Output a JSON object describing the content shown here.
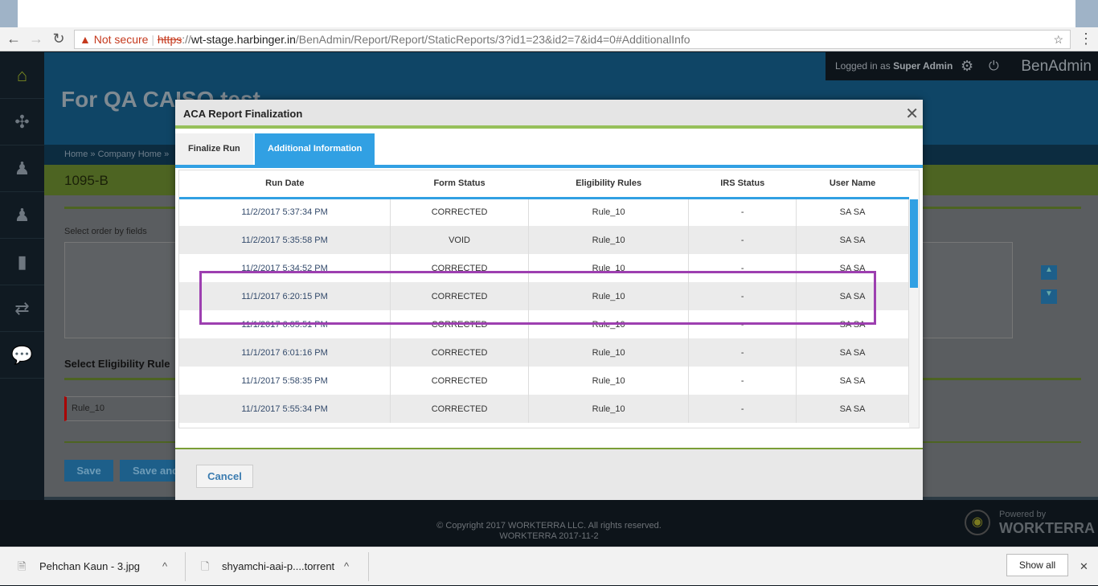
{
  "browser": {
    "security": "Not secure",
    "url_scheme": "https",
    "url_host": "wt-stage.harbinger.in",
    "url_path": "/BenAdmin/Report/Report/StaticReports/3?id1=23&id2=7&id4=0#AdditionalInfo"
  },
  "app": {
    "title": "For QA CAISO test",
    "logged_in_prefix": "Logged in as",
    "user": "Super Admin",
    "brand": "BenAdmin",
    "breadcrumb": "Home » Company Home »",
    "section": "1095-B",
    "order_label": "Select order by fields",
    "elig_label": "Select Eligibility Rule",
    "elig_value": "Rule_10",
    "save": "Save",
    "save_and": "Save and"
  },
  "modal": {
    "title": "ACA Report Finalization",
    "close": "✕",
    "tabs": [
      {
        "label": "Finalize Run",
        "active": false
      },
      {
        "label": "Additional Information",
        "active": true
      }
    ],
    "columns": [
      "Run Date",
      "Form Status",
      "Eligibility Rules",
      "IRS Status",
      "User Name"
    ],
    "rows": [
      [
        "11/2/2017 5:37:34 PM",
        "CORRECTED",
        "Rule_10",
        "-",
        "SA SA"
      ],
      [
        "11/2/2017 5:35:58 PM",
        "VOID",
        "Rule_10",
        "-",
        "SA SA"
      ],
      [
        "11/2/2017 5:34:52 PM",
        "CORRECTED",
        "Rule_10",
        "-",
        "SA SA"
      ],
      [
        "11/1/2017 6:20:15 PM",
        "CORRECTED",
        "Rule_10",
        "-",
        "SA SA"
      ],
      [
        "11/1/2017 6:05:51 PM",
        "CORRECTED",
        "Rule_10",
        "-",
        "SA SA"
      ],
      [
        "11/1/2017 6:01:16 PM",
        "CORRECTED",
        "Rule_10",
        "-",
        "SA SA"
      ],
      [
        "11/1/2017 5:58:35 PM",
        "CORRECTED",
        "Rule_10",
        "-",
        "SA SA"
      ],
      [
        "11/1/2017 5:55:34 PM",
        "CORRECTED",
        "Rule_10",
        "-",
        "SA SA"
      ]
    ],
    "cancel": "Cancel"
  },
  "footer": {
    "copyright": "© Copyright 2017 WORKTERRA LLC. All rights reserved.",
    "version": "WORKTERRA 2017-11-2",
    "powered": "Powered by",
    "powered_brand": "WORKTERRA"
  },
  "downloads": {
    "items": [
      "Pehchan Kaun - 3.jpg",
      "shyamchi-aai-p....torrent"
    ],
    "show_all": "Show all"
  },
  "colors": {
    "accent": "#31a0e3",
    "green": "#96c05a",
    "highlight": "#9d3fb0"
  }
}
